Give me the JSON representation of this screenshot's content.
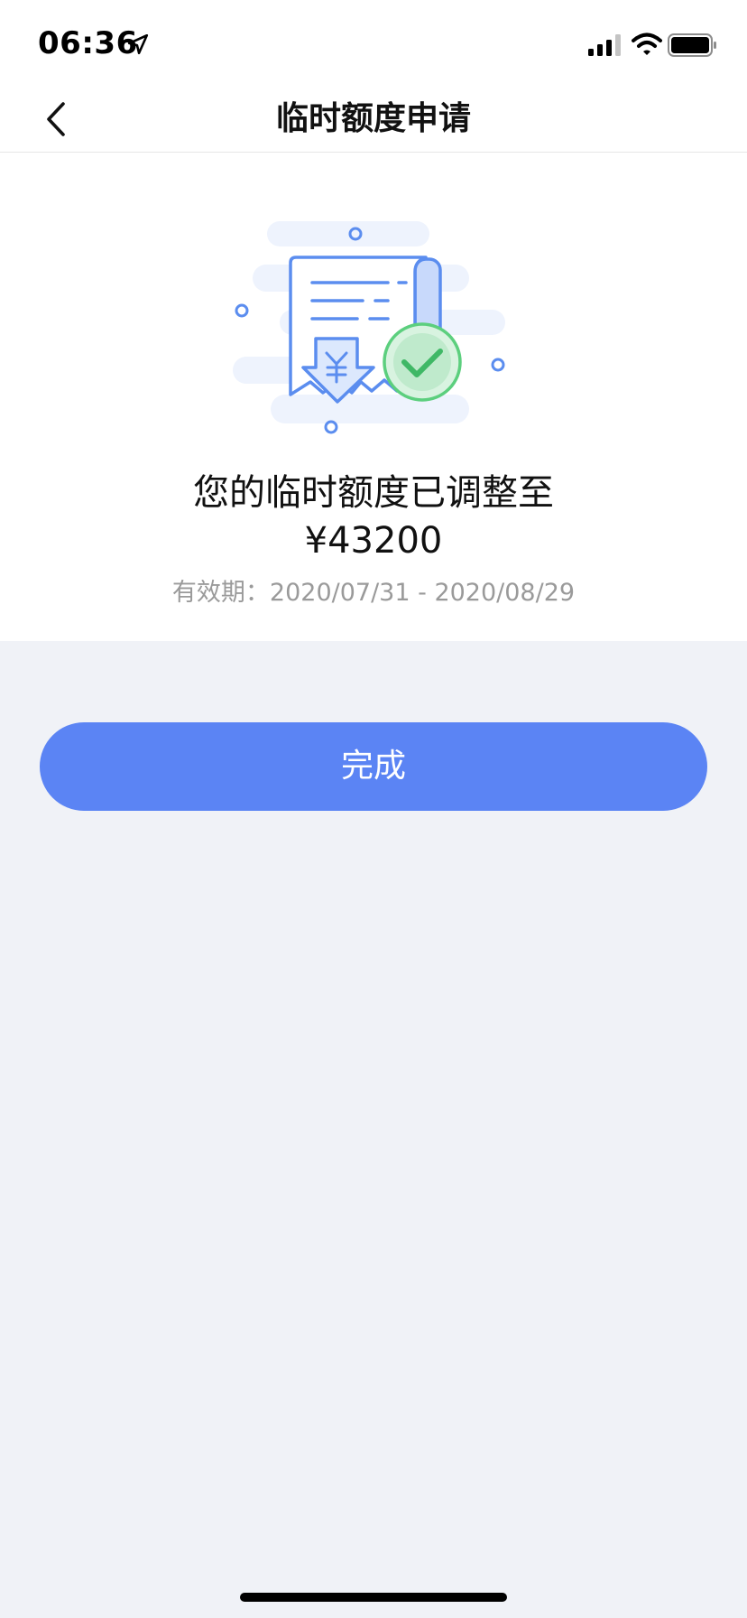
{
  "status_bar": {
    "time": "06:36",
    "icons": [
      "location-arrow-icon",
      "signal-icon",
      "wifi-icon",
      "battery-icon"
    ]
  },
  "nav": {
    "back_icon": "chevron-left-icon",
    "title": "临时额度申请"
  },
  "result": {
    "illustration_icon": "receipt-check-icon",
    "message": "您的临时额度已调整至",
    "amount": "¥43200",
    "validity": "有效期：2020/07/31 - 2020/08/29"
  },
  "actions": {
    "done_label": "完成"
  },
  "colors": {
    "accent": "#5b84f4",
    "success": "#5ccf7e",
    "background": "#f0f2f7"
  }
}
